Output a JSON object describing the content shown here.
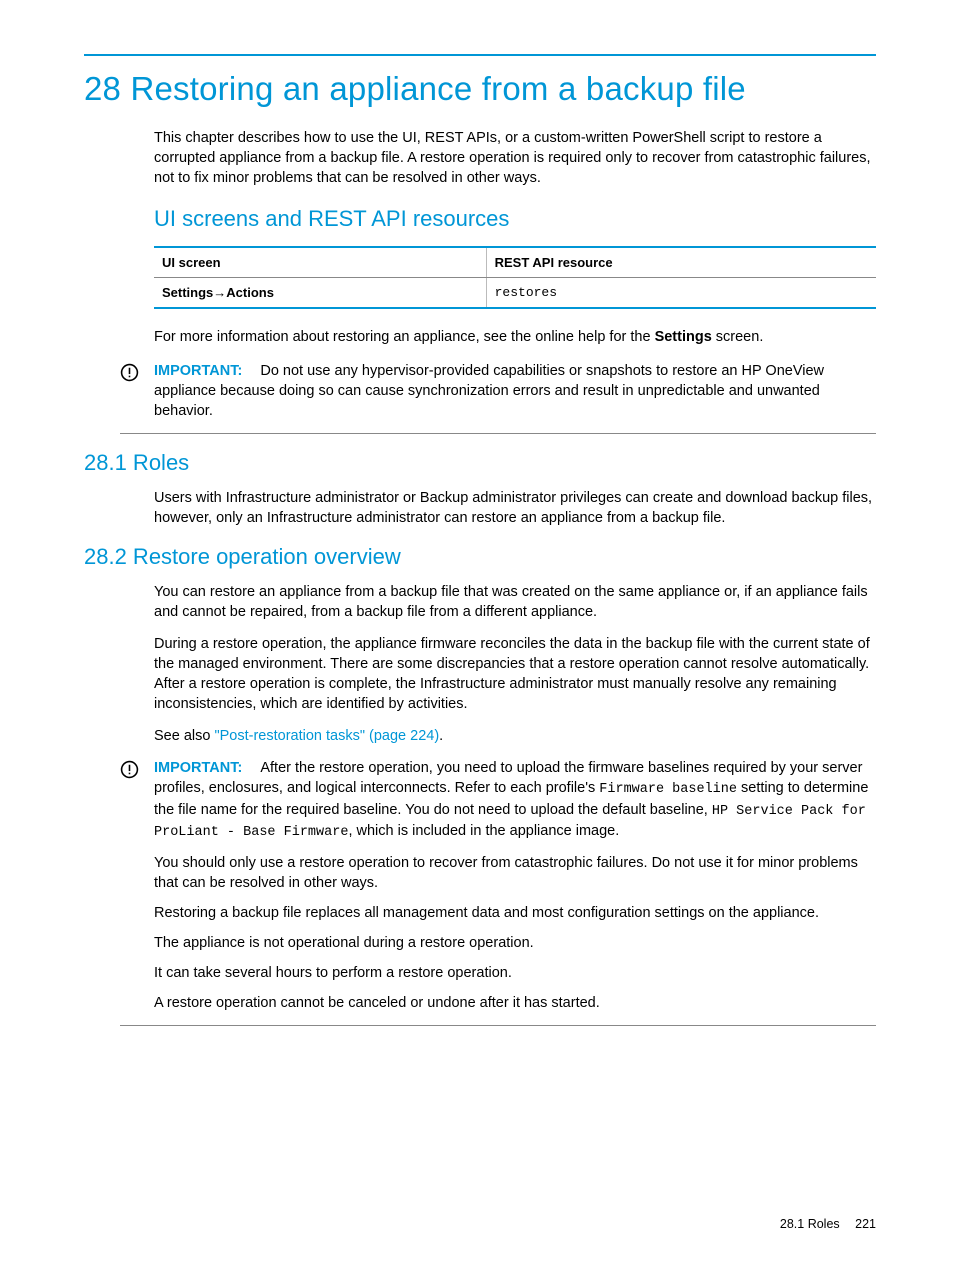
{
  "chapter": {
    "title": "28 Restoring an appliance from a backup file",
    "intro": "This chapter describes how to use the UI, REST APIs, or a custom-written PowerShell script to restore a corrupted appliance from a backup file. A restore operation is required only to recover from catastrophic failures, not to fix minor problems that can be resolved in other ways."
  },
  "subheading1": "UI screens and REST API resources",
  "table": {
    "headers": [
      "UI screen",
      "REST API resource"
    ],
    "row": {
      "uiscreen_prefix": "Settings",
      "uiscreen_arrow": "→",
      "uiscreen_suffix": "Actions",
      "resource": "restores"
    }
  },
  "more_info": {
    "prefix": "For more information about restoring an appliance, see the online help for the ",
    "bold": "Settings",
    "suffix": " screen."
  },
  "important1": {
    "label": "IMPORTANT:",
    "text": "Do not use any hypervisor-provided capabilities or snapshots to restore an HP OneView appliance because doing so can cause synchronization errors and result in unpredictable and unwanted behavior."
  },
  "section1": {
    "heading": "28.1 Roles",
    "body": "Users with Infrastructure administrator or Backup administrator privileges can create and download backup files, however, only an Infrastructure administrator can restore an appliance from a backup file."
  },
  "section2": {
    "heading": "28.2 Restore operation overview",
    "p1": "You can restore an appliance from a backup file that was created on the same appliance or, if an appliance fails and cannot be repaired, from a backup file from a different appliance.",
    "p2": "During a restore operation, the appliance firmware reconciles the data in the backup file with the current state of the managed environment. There are some discrepancies that a restore operation cannot resolve automatically. After a restore operation is complete, the Infrastructure administrator must manually resolve any remaining inconsistencies, which are identified by activities.",
    "seealso_prefix": "See also ",
    "seealso_link": "\"Post-restoration tasks\" (page 224)",
    "seealso_suffix": "."
  },
  "important2": {
    "label": "IMPORTANT:",
    "p1_a": "After the restore operation, you need to upload the firmware baselines required by your server profiles, enclosures, and logical interconnects. Refer to each profile's ",
    "p1_code1": "Firmware baseline",
    "p1_b": " setting to determine the file name for the required baseline. You do not need to upload the default baseline, ",
    "p1_code2": "HP Service Pack for ProLiant - Base Firmware",
    "p1_c": ", which is included in the appliance image.",
    "p2": "You should only use a restore operation to recover from catastrophic failures. Do not use it for minor problems that can be resolved in other ways.",
    "p3": "Restoring a backup file replaces all management data and most configuration settings on the appliance.",
    "p4": "The appliance is not operational during a restore operation.",
    "p5": "It can take several hours to perform a restore operation.",
    "p6": "A restore operation cannot be canceled or undone after it has started."
  },
  "footer": {
    "section": "28.1 Roles",
    "page": "221"
  }
}
